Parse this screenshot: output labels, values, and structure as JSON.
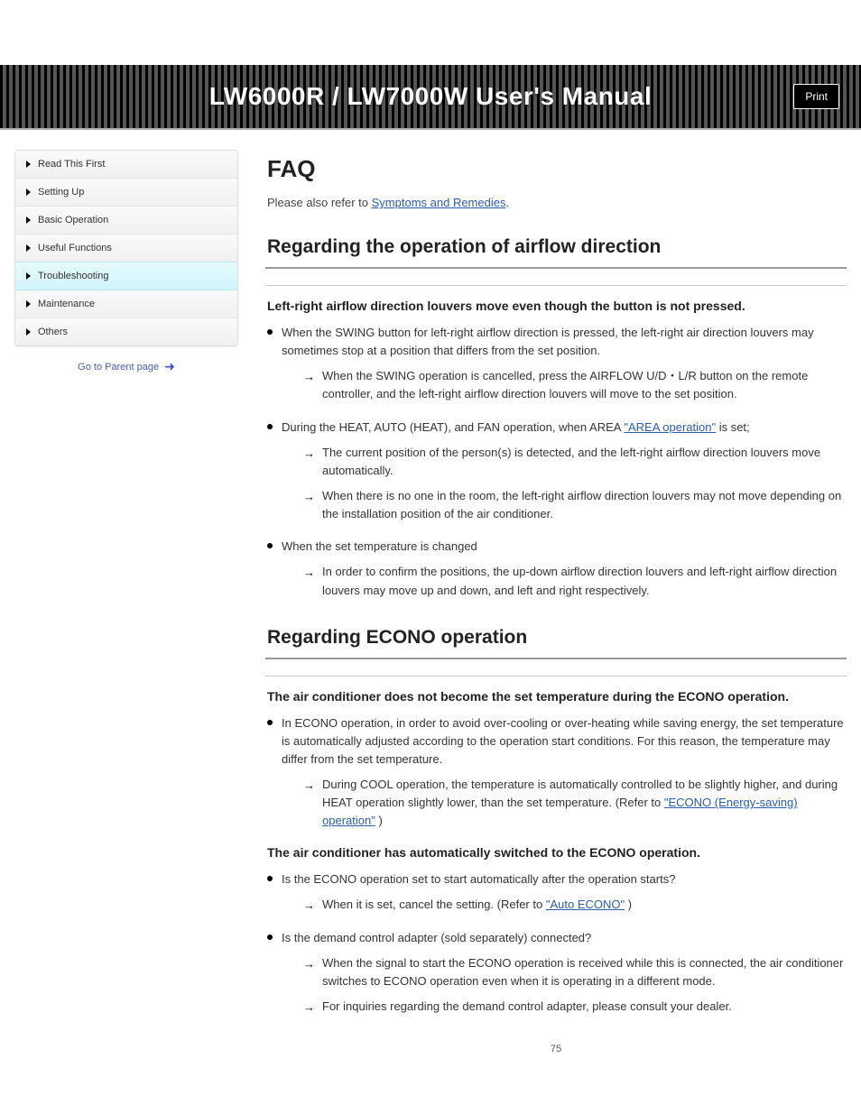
{
  "banner": {
    "title": "LW6000R / LW7000W User's Manual",
    "print_label": "Print"
  },
  "sidebar": {
    "items": [
      {
        "label": "Read This First"
      },
      {
        "label": "Setting Up"
      },
      {
        "label": "Basic Operation"
      },
      {
        "label": "Useful Functions"
      },
      {
        "label": "Troubleshooting"
      },
      {
        "label": "Maintenance"
      },
      {
        "label": "Others"
      }
    ],
    "active_index": 4,
    "parent_link": "Go to Parent page"
  },
  "content": {
    "title": "FAQ",
    "lead": "Please also refer to \"Symptoms and Remedies\".",
    "lead_link": "Symptoms and Remedies",
    "sections": [
      {
        "heading": "Regarding the operation of airflow direction",
        "faqs": [
          {
            "question": "Left-right airflow direction louvers move even though the button is not pressed.",
            "bullets": [
              {
                "text": "When the SWING button for left-right airflow direction is pressed, the left-right air direction louvers may sometimes stop at a position that differs from the set position.",
                "actions": [
                  {
                    "text": "When the SWING operation is cancelled, press the AIRFLOW U/D・L/R button on the remote controller, and the left-right airflow direction louvers will move to the set position."
                  }
                ]
              },
              {
                "text_pre": "During the HEAT, AUTO (HEAT), and FAN operation, when AREA ",
                "link": "\"AREA operation\"",
                "text_post": " is set;",
                "actions": [
                  {
                    "text": "The current position of the person(s) is detected, and the left-right airflow direction louvers move automatically."
                  },
                  {
                    "text": "When there is no one in the room, the left-right airflow direction louvers may not move depending on the installation position of the air conditioner."
                  }
                ]
              },
              {
                "text": "When the set temperature is changed",
                "actions": [
                  {
                    "text": "In order to confirm the positions, the up-down airflow direction louvers and left-right airflow direction louvers may move up and down, and left and right respectively."
                  }
                ]
              }
            ]
          }
        ]
      },
      {
        "heading": "Regarding ECONO operation",
        "faqs": [
          {
            "question": "The air conditioner does not become the set temperature during the ECONO operation.",
            "bullets": [
              {
                "text": "In ECONO operation, in order to avoid over-cooling or over-heating while saving energy, the set temperature is automatically adjusted according to the operation start conditions. For this reason, the temperature may differ from the set temperature.",
                "actions": [
                  {
                    "text_pre": "During COOL operation, the temperature is automatically controlled to be slightly higher, and during HEAT operation slightly lower, than the set temperature. (Refer to ",
                    "link": "\"ECONO (Energy-saving) operation\"",
                    "text_post": ")"
                  }
                ]
              }
            ]
          },
          {
            "question": "The air conditioner has automatically switched to the ECONO operation.",
            "bullets": [
              {
                "text": "Is the ECONO operation set to start automatically after the operation starts?",
                "actions": [
                  {
                    "text_pre": "When it is set, cancel the setting. (Refer to ",
                    "link": "\"Auto ECONO\"",
                    "text_post": ")"
                  }
                ]
              },
              {
                "text": "Is the demand control adapter (sold separately) connected?",
                "actions": [
                  {
                    "text": "When the signal to start the ECONO operation is received while this is connected, the air conditioner switches to ECONO operation even when it is operating in a different mode."
                  },
                  {
                    "text": "For inquiries regarding the demand control adapter, please consult your dealer."
                  }
                ]
              }
            ]
          }
        ]
      }
    ],
    "page_number": "75"
  }
}
